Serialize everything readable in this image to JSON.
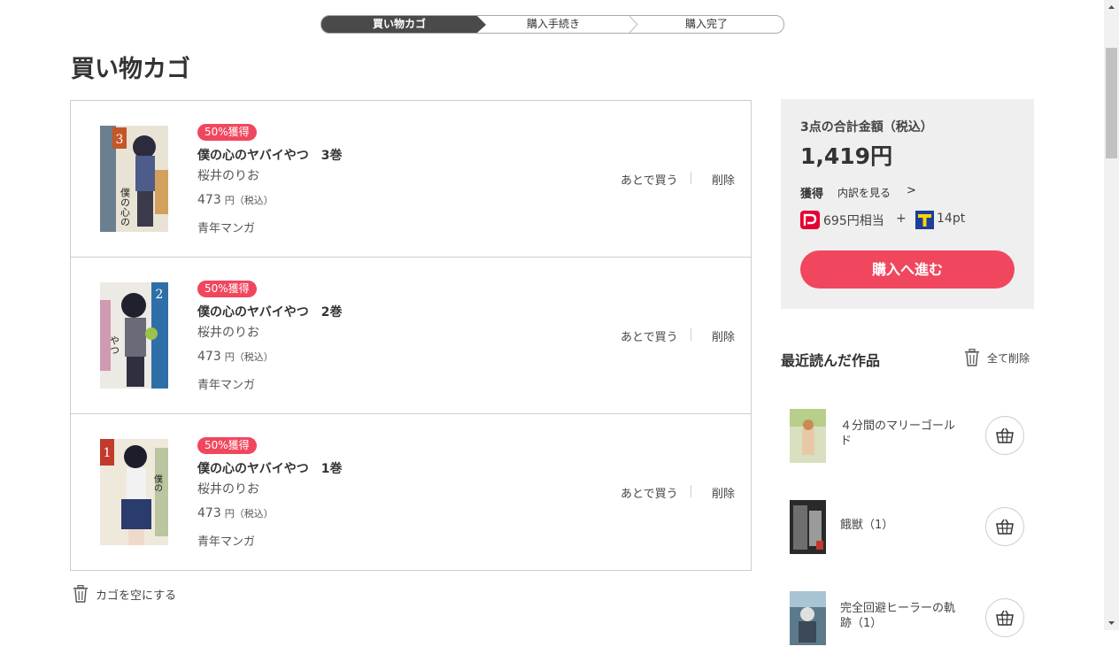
{
  "stepper": {
    "steps": [
      {
        "label": "買い物カゴ",
        "active": true
      },
      {
        "label": "購入手続き",
        "active": false
      },
      {
        "label": "購入完了",
        "active": false
      }
    ]
  },
  "page": {
    "title": "買い物カゴ"
  },
  "cart": {
    "items": [
      {
        "badge": "50%獲得",
        "title": "僕の心のヤバイやつ　3巻",
        "author": "桜井のりお",
        "price": "473",
        "price_unit": "円（税込）",
        "genre": "青年マンガ",
        "later_label": "あとで買う",
        "delete_label": "削除",
        "cover_number": "3"
      },
      {
        "badge": "50%獲得",
        "title": "僕の心のヤバイやつ　2巻",
        "author": "桜井のりお",
        "price": "473",
        "price_unit": "円（税込）",
        "genre": "青年マンガ",
        "later_label": "あとで買う",
        "delete_label": "削除",
        "cover_number": "2"
      },
      {
        "badge": "50%獲得",
        "title": "僕の心のヤバイやつ　1巻",
        "author": "桜井のりお",
        "price": "473",
        "price_unit": "円（税込）",
        "genre": "青年マンガ",
        "later_label": "あとで買う",
        "delete_label": "削除",
        "cover_number": "1"
      }
    ],
    "empty_label": "カゴを空にする"
  },
  "summary": {
    "total_label": "3点の合計金額（税込）",
    "total_value": "1,419円",
    "earn_label": "獲得",
    "earn_detail_link": "内訳を見る",
    "paypay_text": "695円相当",
    "plus": "+",
    "tpoint_text": "14pt",
    "buy_button": "購入へ進む"
  },
  "recent": {
    "title": "最近読んだ作品",
    "clear_all": "全て削除",
    "items": [
      {
        "name": "４分間のマリーゴールド"
      },
      {
        "name": "餓獣（1）"
      },
      {
        "name": "完全回避ヒーラーの軌跡（1）"
      }
    ]
  },
  "colors": {
    "accent": "#f0475e",
    "stepper_active": "#4a4a4a",
    "summary_bg": "#efefef"
  }
}
